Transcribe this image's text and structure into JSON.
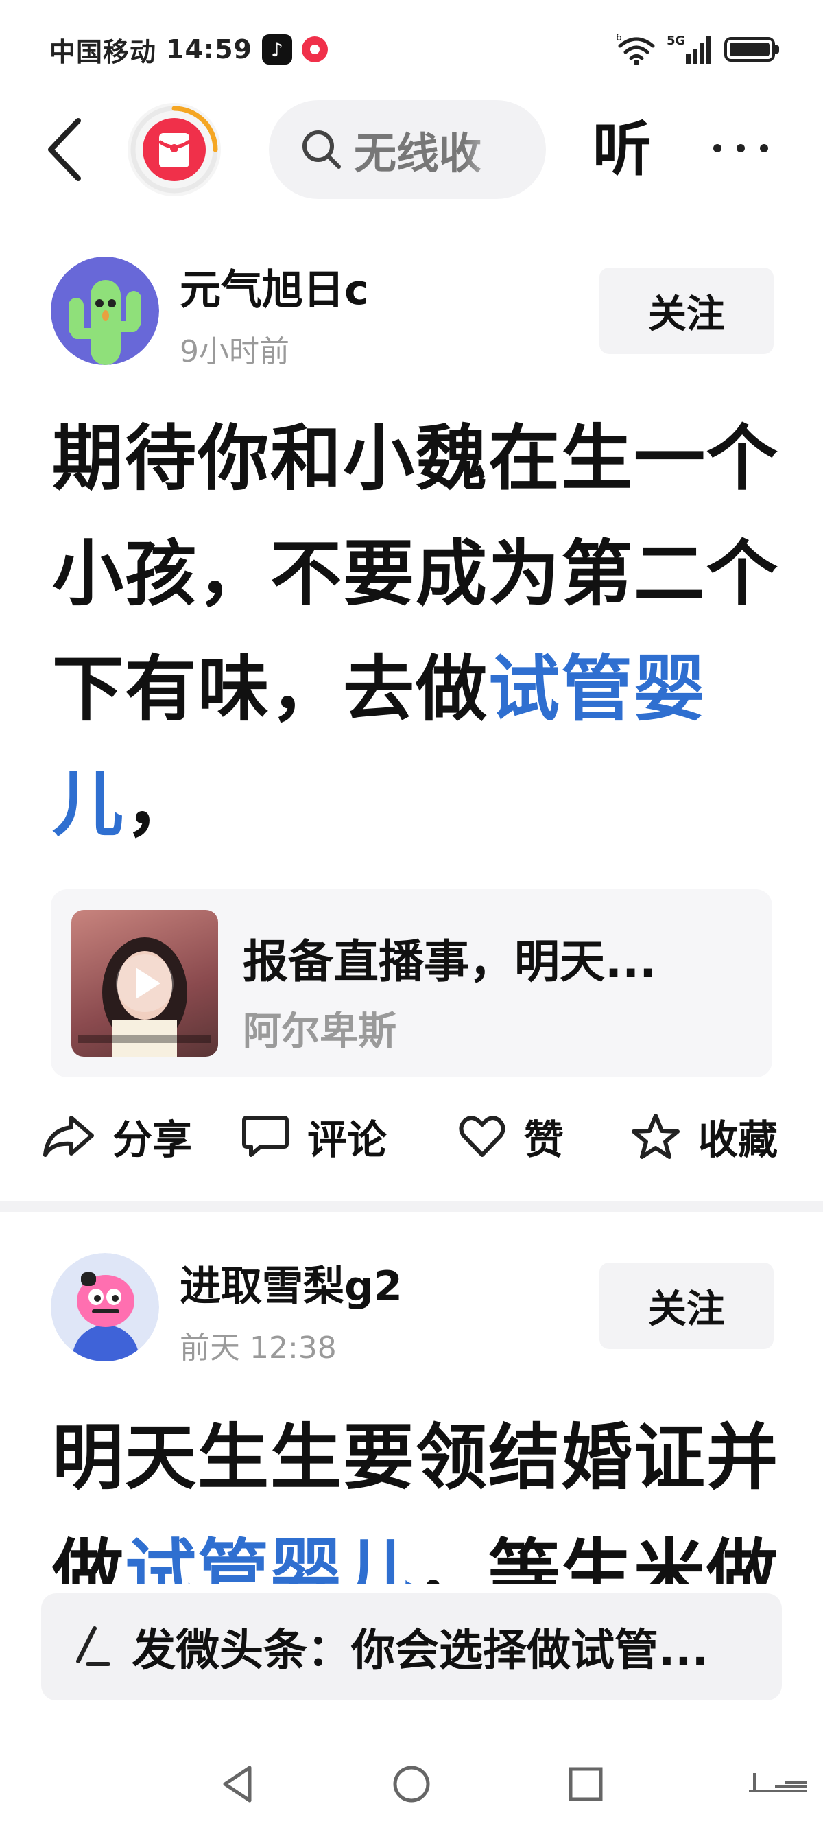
{
  "status_bar": {
    "carrier": "中国移动",
    "time": "14:59",
    "network": "5G",
    "wifi_label": "6"
  },
  "top_nav": {
    "search_text": "无线收",
    "listen_label": "听"
  },
  "posts": [
    {
      "username": "元气旭日c",
      "time": "9小时前",
      "follow_label": "关注",
      "body_lines": [
        "期待你和小魏在生一个",
        "小孩，不要成为第二个"
      ],
      "line3_plain": "下有味，去做",
      "line3_link": "试管婴",
      "line4_link": "儿",
      "line4_plain": "，",
      "card_title": "报备直播事，明天...",
      "card_author": "阿尔卑斯",
      "share_label": "分享",
      "comment_label": "评论",
      "like_label": "赞",
      "favorite_label": "收藏"
    },
    {
      "username": "进取雪梨g2",
      "time": "前天  12:38",
      "follow_label": "关注",
      "body_line1": "明天生生要领结婚证并",
      "body_line2_plain": "做",
      "body_line2_link": "试管婴儿",
      "body_line2_rest": "，等生米做"
    }
  ],
  "composer": {
    "text": "发微头条：你会选择做试管..."
  },
  "colors": {
    "link": "#2f6fd0",
    "logo_red": "#f0304a",
    "ring_orange": "#f5a623"
  }
}
